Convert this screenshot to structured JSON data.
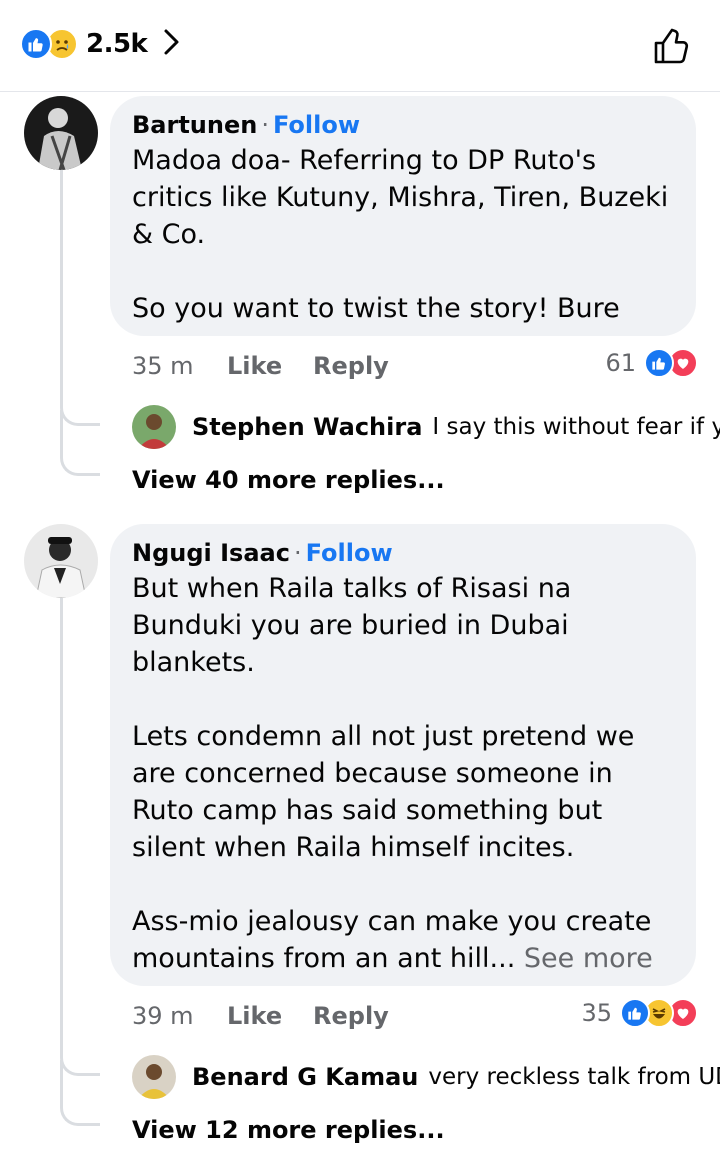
{
  "header": {
    "reaction_count": "2.5k",
    "reactions": [
      "like-icon",
      "sad-icon"
    ]
  },
  "comments": [
    {
      "author": "Bartunen",
      "separator": "·",
      "follow_label": "Follow",
      "text": "Madoa doa- Referring to DP Ruto's critics like Kutuny,   Mishra, Tiren, Buzeki & Co.\n\nSo you want to twist the story! Bure",
      "see_more": "",
      "time": "35 m",
      "like_label": "Like",
      "reply_label": "Reply",
      "reaction_count": "61",
      "reactions": [
        "like-icon",
        "love-icon"
      ],
      "reply_preview": {
        "author": "Stephen Wachira",
        "text": "I say this without fear if yo..."
      },
      "view_more_replies": "View 40 more replies..."
    },
    {
      "author": "Ngugi Isaac",
      "separator": "·",
      "follow_label": "Follow",
      "text": "But when Raila talks of Risasi na Bunduki you are buried in Dubai blankets.\n\nLets condemn all not just pretend we are concerned because someone in Ruto camp has said something but silent when Raila himself incites.\n\nAss-mio jealousy can make you create mountains from an ant hill...",
      "see_more": " See more",
      "time": "39 m",
      "like_label": "Like",
      "reply_label": "Reply",
      "reaction_count": "35",
      "reactions": [
        "like-icon",
        "haha-icon",
        "love-icon"
      ],
      "reply_preview": {
        "author": "Benard G Kamau",
        "text": "very reckless talk from UDA"
      },
      "view_more_replies": "View 12 more replies..."
    }
  ],
  "colors": {
    "accent": "#1877f2",
    "bubble": "#f0f2f5",
    "secondary_text": "#65676b",
    "love": "#f33e58",
    "emoji_yellow": "#f7c531"
  }
}
